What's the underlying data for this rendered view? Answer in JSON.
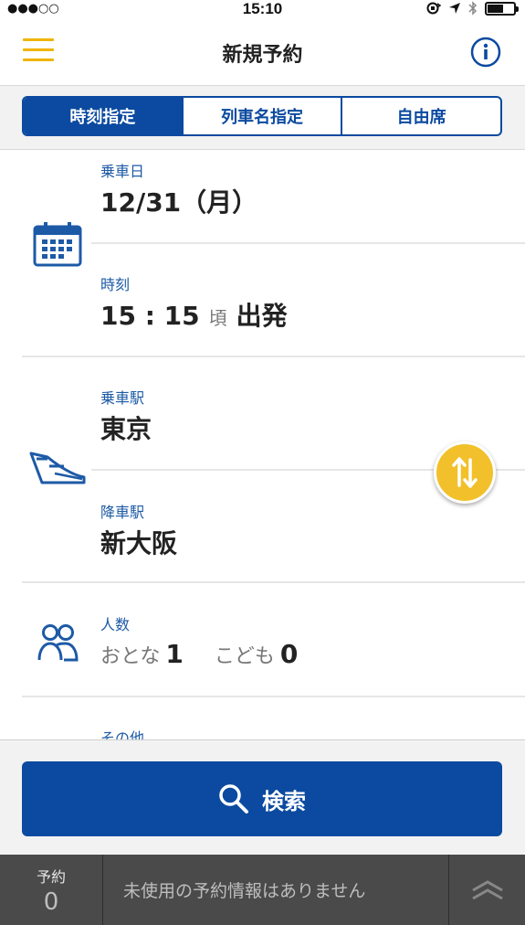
{
  "status": {
    "signal": "●●●○○",
    "time": "15:10",
    "battery_level": 0.6
  },
  "nav": {
    "title": "新規予約"
  },
  "tabs": [
    {
      "label": "時刻指定",
      "active": true
    },
    {
      "label": "列車名指定",
      "active": false
    },
    {
      "label": "自由席",
      "active": false
    }
  ],
  "form": {
    "date": {
      "label": "乗車日",
      "value": "12/31（月）"
    },
    "time": {
      "label": "時刻",
      "value": "15 : 15",
      "approx": "頃",
      "direction": "出発"
    },
    "departure": {
      "label": "乗車駅",
      "value": "東京"
    },
    "arrival": {
      "label": "降車駅",
      "value": "新大阪"
    },
    "passengers": {
      "label": "人数",
      "adult_label": "おとな",
      "adult_count": "1",
      "child_label": "こども",
      "child_count": "0"
    },
    "other": {
      "label": "その他"
    }
  },
  "search": {
    "label": "検索"
  },
  "bottom": {
    "reservation_label": "予約",
    "reservation_count": "0",
    "message": "未使用の予約情報はありません"
  },
  "colors": {
    "brand_blue": "#0b4aa0",
    "accent_yellow": "#f2c02a",
    "label_blue": "#1d5aa6"
  }
}
